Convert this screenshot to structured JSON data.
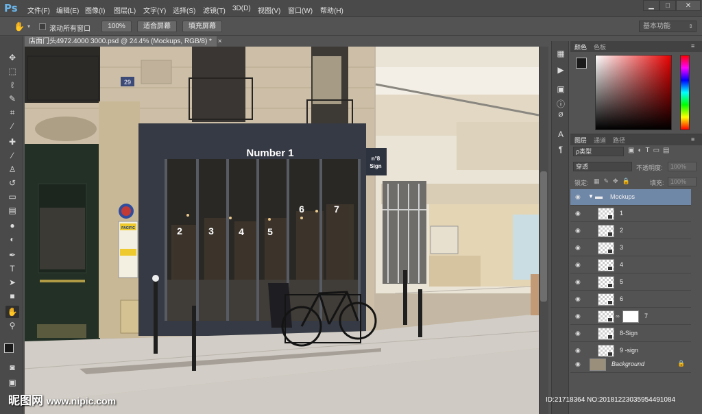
{
  "app": {
    "logo": "Ps"
  },
  "menu": [
    "文件(F)",
    "编辑(E)",
    "图像(I)",
    "图层(L)",
    "文字(Y)",
    "选择(S)",
    "滤镜(T)",
    "3D(D)",
    "视图(V)",
    "窗口(W)",
    "帮助(H)"
  ],
  "options": {
    "scroll_all_label": "滚动所有窗口",
    "zoom_100": "100%",
    "fit_screen": "适合屏幕",
    "fill_screen": "填充屏幕",
    "workspace": "基本功能"
  },
  "document": {
    "tab_title": "店面门头4972.4000 3000.psd @ 24.4% (Mockups, RGB/8) *",
    "sign_text": "Number 1",
    "badge_text": "n°8 Sign",
    "window_numbers": [
      "2",
      "3",
      "4",
      "5",
      "6",
      "7"
    ],
    "house_number": "29",
    "poster_text": "PACIFIC"
  },
  "color_panel": {
    "tabs": [
      "颜色",
      "色板"
    ]
  },
  "layers_panel": {
    "tabs": [
      "图层",
      "通道",
      "路径"
    ],
    "filter_kind": "ρ类型",
    "blend_mode": "穿透",
    "opacity_label": "不透明度:",
    "opacity_value": "100%",
    "lock_label": "锁定:",
    "fill_label": "填充:",
    "fill_value": "100%",
    "layers": [
      {
        "name": "Mockups",
        "type": "group"
      },
      {
        "name": "1",
        "type": "smart"
      },
      {
        "name": "2",
        "type": "smart"
      },
      {
        "name": "3",
        "type": "smart"
      },
      {
        "name": "4",
        "type": "smart"
      },
      {
        "name": "5",
        "type": "smart"
      },
      {
        "name": "6",
        "type": "smart"
      },
      {
        "name": "7",
        "type": "smart-mask"
      },
      {
        "name": "8-Sign",
        "type": "smart"
      },
      {
        "name": "9 -sign",
        "type": "smart"
      },
      {
        "name": "Background",
        "type": "background"
      }
    ]
  },
  "status": {
    "id_text": "ID:21718364 NO:20181223035954491084"
  },
  "watermark": {
    "site": "昵图网",
    "url": "www.nipic.com"
  }
}
